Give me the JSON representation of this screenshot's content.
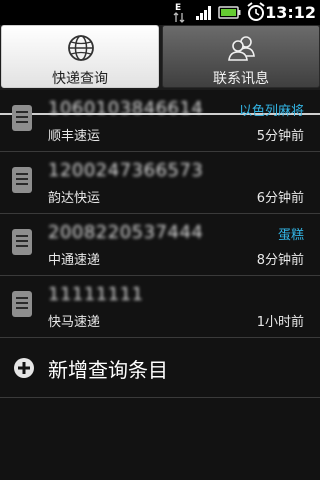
{
  "status_bar": {
    "clock": "13:12",
    "icons": [
      "data-e-icon",
      "signal-icon",
      "battery-icon",
      "alarm-clock-icon"
    ]
  },
  "tabs": [
    {
      "label": "快递查询",
      "icon": "globe-icon",
      "active": true
    },
    {
      "label": "联系讯息",
      "icon": "contacts-icon",
      "active": false
    }
  ],
  "records": [
    {
      "tracking": "1060103846614",
      "note": "以色列麻将",
      "carrier": "顺丰速运",
      "time": "5分钟前"
    },
    {
      "tracking": "1200247366573",
      "note": "",
      "carrier": "韵达快运",
      "time": "6分钟前"
    },
    {
      "tracking": "2008220537444",
      "note": "蛋糕",
      "carrier": "中通速递",
      "time": "8分钟前"
    },
    {
      "tracking": "11111111",
      "note": "",
      "carrier": "快马速递",
      "time": "1小时前"
    }
  ],
  "add_entry": {
    "label": "新增查询条目",
    "icon": "plus-icon"
  },
  "colors": {
    "accent": "#33b5e5",
    "background": "#121212"
  }
}
